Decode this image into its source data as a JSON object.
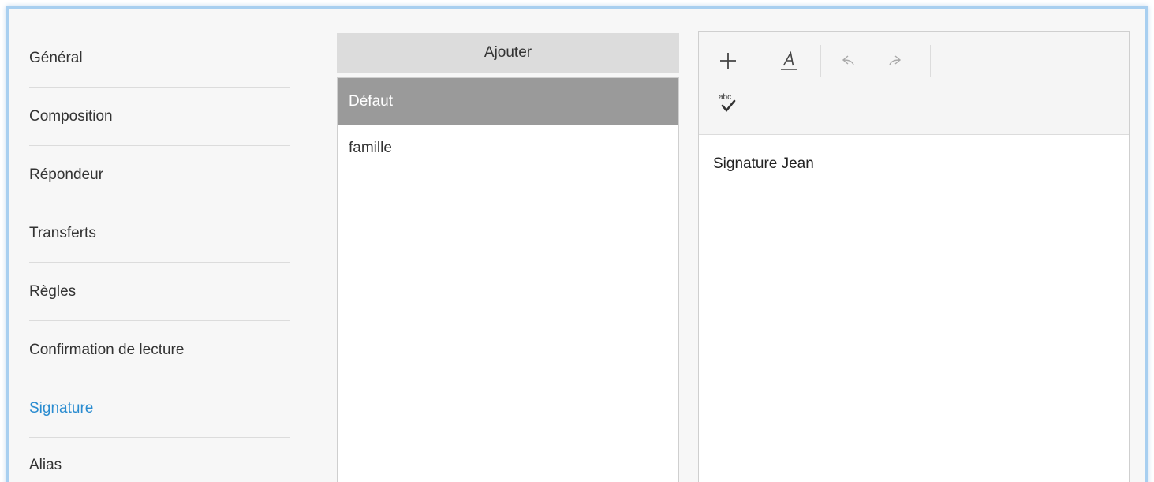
{
  "nav": {
    "items": [
      {
        "label": "Général"
      },
      {
        "label": "Composition"
      },
      {
        "label": "Répondeur"
      },
      {
        "label": "Transferts"
      },
      {
        "label": "Règles"
      },
      {
        "label": "Confirmation de lecture"
      },
      {
        "label": "Signature"
      },
      {
        "label": "Alias"
      }
    ],
    "active": "Signature"
  },
  "signatures": {
    "add_label": "Ajouter",
    "items": [
      {
        "label": "Défaut",
        "selected": true
      },
      {
        "label": "famille",
        "selected": false
      }
    ]
  },
  "editor": {
    "toolbar": {
      "icons": [
        "plus-icon",
        "text-color-icon",
        "undo-icon",
        "redo-icon",
        "spellcheck-icon"
      ],
      "spellcheck_text": "abc"
    },
    "content": "Signature Jean"
  },
  "colors": {
    "accent": "#2a8cd0",
    "selected_row": "#9a9a9a",
    "frame_border": "#a8cff0"
  }
}
